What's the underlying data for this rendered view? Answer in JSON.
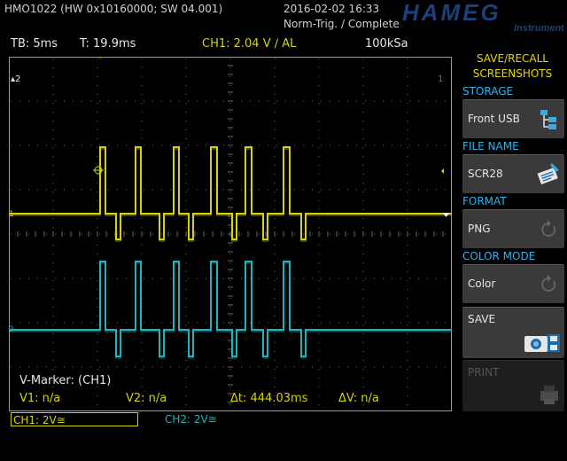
{
  "header": {
    "device": "HMO1022 (HW 0x10160000; SW 04.001)",
    "datetime": "2016-02-02 16:33",
    "status": "Norm-Trig. / Complete",
    "logo_text": "HAMEG",
    "logo_sub": "Instruments"
  },
  "info_bar": {
    "timebase": "TB: 5ms",
    "trigger_time": "T: 19.9ms",
    "trigger": "CH1: 2.04 V ∕ AL",
    "sample_rate": "100kSa"
  },
  "screen": {
    "ch1_marker": "1",
    "ch2_marker": "2",
    "marker_top_left": "▴2",
    "marker_top_right": "1",
    "vmarker_title": "V-Marker: (CH1)",
    "v1": "V1: n/a",
    "v2": "V2: n/a",
    "dt": "Δt: 444.03ms",
    "dv": "ΔV: n/a"
  },
  "channels": {
    "ch1_label": "CH1: 2V≅",
    "ch2_label": "CH2: 2V≅",
    "ch1_color": "#d8d300",
    "ch2_color": "#19b7bd"
  },
  "menu": {
    "title_line1": "SAVE/RECALL",
    "title_line2": "SCREENSHOTS",
    "storage_head": "STORAGE",
    "storage_value": "Front USB",
    "storage_icon": "usb-folder-icon",
    "filename_head": "FILE NAME",
    "filename_value": "SCR28",
    "filename_icon": "keyboard-edit-icon",
    "format_head": "FORMAT",
    "format_value": "PNG",
    "color_head": "COLOR MODE",
    "color_value": "Color",
    "save_label": "SAVE",
    "save_icon": "camera-save-icon",
    "print_label": "PRINT",
    "print_icon": "printer-icon"
  }
}
